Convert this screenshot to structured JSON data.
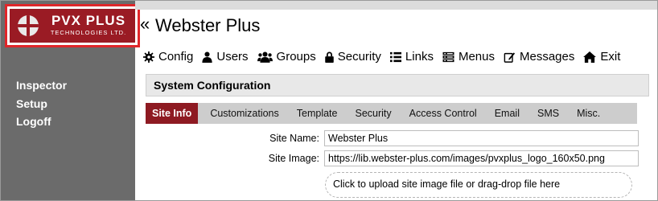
{
  "logo": {
    "title": "PVX PLUS",
    "subtitle": "TECHNOLOGIES LTD."
  },
  "sidebar": {
    "items": [
      {
        "label": "Inspector"
      },
      {
        "label": "Setup"
      },
      {
        "label": "Logoff"
      }
    ]
  },
  "header": {
    "back_glyph": "«",
    "title": "Webster Plus"
  },
  "menu": {
    "items": [
      {
        "label": "Config",
        "icon": "gear-icon"
      },
      {
        "label": "Users",
        "icon": "user-icon"
      },
      {
        "label": "Groups",
        "icon": "users-icon"
      },
      {
        "label": "Security",
        "icon": "lock-icon"
      },
      {
        "label": "Links",
        "icon": "list-icon"
      },
      {
        "label": "Menus",
        "icon": "menu-icon"
      },
      {
        "label": "Messages",
        "icon": "edit-icon"
      },
      {
        "label": "Exit",
        "icon": "home-icon"
      }
    ]
  },
  "panel": {
    "title": "System Configuration"
  },
  "tabs": [
    {
      "label": "Site Info",
      "active": true
    },
    {
      "label": "Customizations"
    },
    {
      "label": "Template"
    },
    {
      "label": "Security"
    },
    {
      "label": "Access Control"
    },
    {
      "label": "Email"
    },
    {
      "label": "SMS"
    },
    {
      "label": "Misc."
    }
  ],
  "form": {
    "site_name_label": "Site Name:",
    "site_name_value": "Webster Plus",
    "site_image_label": "Site Image:",
    "site_image_value": "https://lib.webster-plus.com/images/pvxplus_logo_160x50.png",
    "upload_text": "Click to upload site image file or drag-drop file here"
  },
  "colors": {
    "brand": "#9a1b24",
    "sidebar": "#6b6b6b",
    "highlight_border": "#e0262a",
    "tab_bar": "#cdcdcd"
  }
}
